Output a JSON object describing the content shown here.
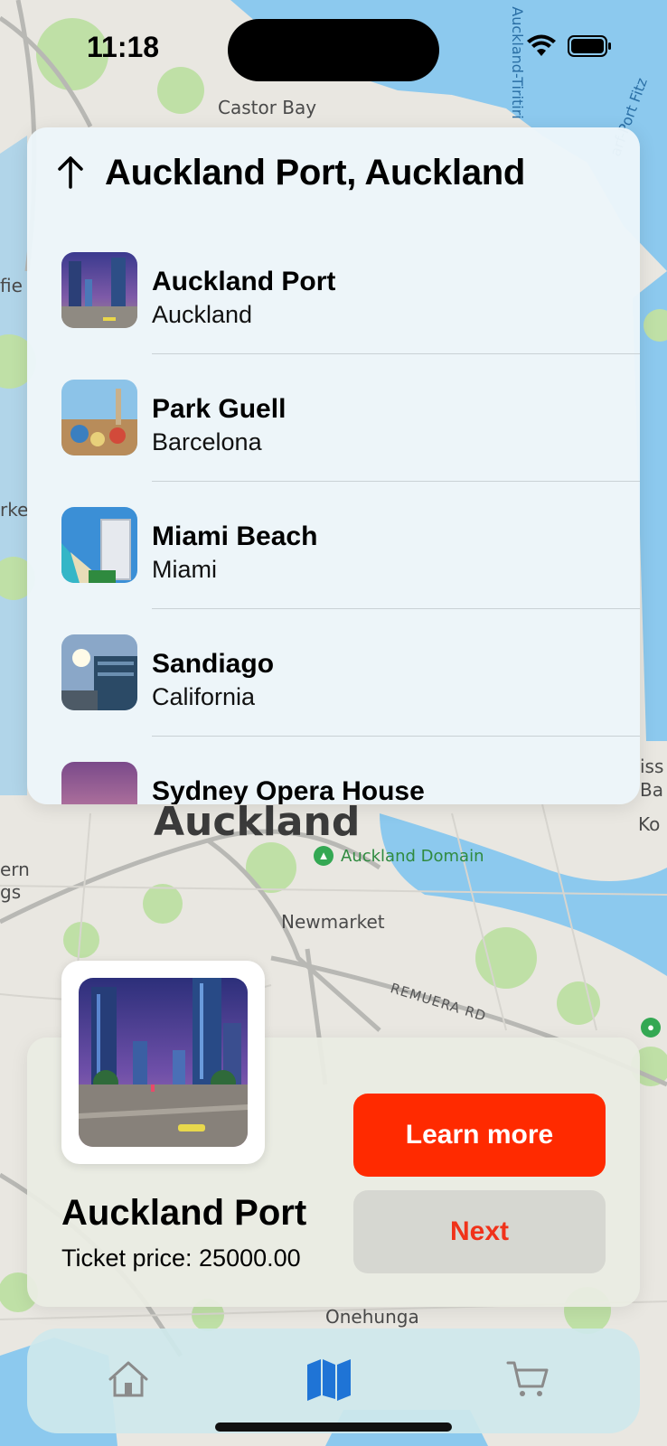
{
  "status_bar": {
    "time": "11:18"
  },
  "map": {
    "labels": {
      "castor_bay": "Castor Bay",
      "city": "Auckland",
      "park": "Auckland Domain",
      "newmarket": "Newmarket",
      "road": "REMUERA RD",
      "onehunga": "Onehunga",
      "edge_left_1": "fie",
      "edge_left_2": "rke",
      "edge_left_3": "ern",
      "edge_left_4": "gs",
      "edge_right_1": "iss",
      "edge_right_2": "Ba",
      "edge_right_3": "Ko",
      "water_1": "Auckland-Tiritiri",
      "water_2": "arf-Port Fitz"
    }
  },
  "search_panel": {
    "title": "Auckland Port, Auckland",
    "items": [
      {
        "title": "Auckland Port",
        "subtitle": "Auckland"
      },
      {
        "title": "Park Guell",
        "subtitle": "Barcelona"
      },
      {
        "title": "Miami Beach",
        "subtitle": "Miami"
      },
      {
        "title": "Sandiago",
        "subtitle": "California"
      },
      {
        "title": "Sydney Opera House",
        "subtitle": ""
      }
    ]
  },
  "detail_card": {
    "title": "Auckland Port",
    "price": "Ticket price: 25000.00",
    "learn_more_label": "Learn more",
    "next_label": "Next"
  },
  "tab_bar": {
    "tabs": [
      {
        "icon": "home-icon",
        "selected": false
      },
      {
        "icon": "map-icon",
        "selected": true
      },
      {
        "icon": "cart-icon",
        "selected": false
      }
    ]
  },
  "colors": {
    "primary_button": "#ff2a00",
    "secondary_button_text": "#f0321a",
    "selected_tab": "#1f74d6",
    "unselected_tab": "#8a8a8a"
  }
}
